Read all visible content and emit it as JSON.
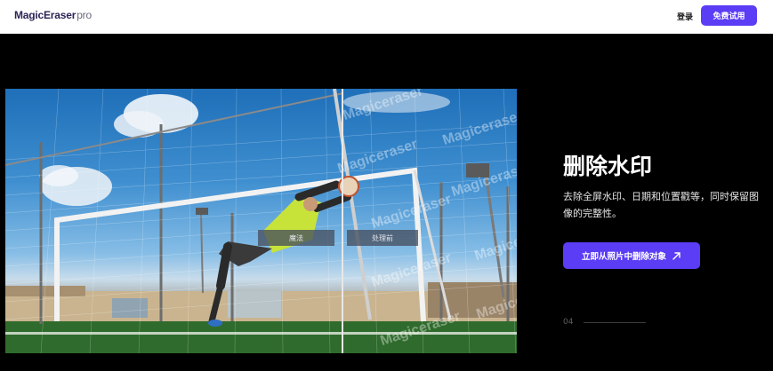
{
  "header": {
    "logo_main": "MagicEraser",
    "logo_suffix": "pro",
    "login_label": "登录",
    "trial_label": "免费试用"
  },
  "demo": {
    "label_after": "魔法",
    "label_before": "处理前",
    "watermarks": [
      "Magiceraser",
      "Magiceraser",
      "Magiceraser",
      "Magiceraser",
      "Magiceraser",
      "Magiceraser",
      "Magiceraser",
      "Magiceraser",
      "Magiceraser"
    ]
  },
  "feature": {
    "title": "删除水印",
    "description": "去除全屏水印、日期和位置戳等，同时保留图像的完整性。",
    "cta_label": "立即从照片中删除对象",
    "cta_icon": "arrow-up-right-icon",
    "slide_number": "04"
  },
  "colors": {
    "accent": "#5b3df5",
    "background": "#000000",
    "header_bg": "#ffffff"
  }
}
